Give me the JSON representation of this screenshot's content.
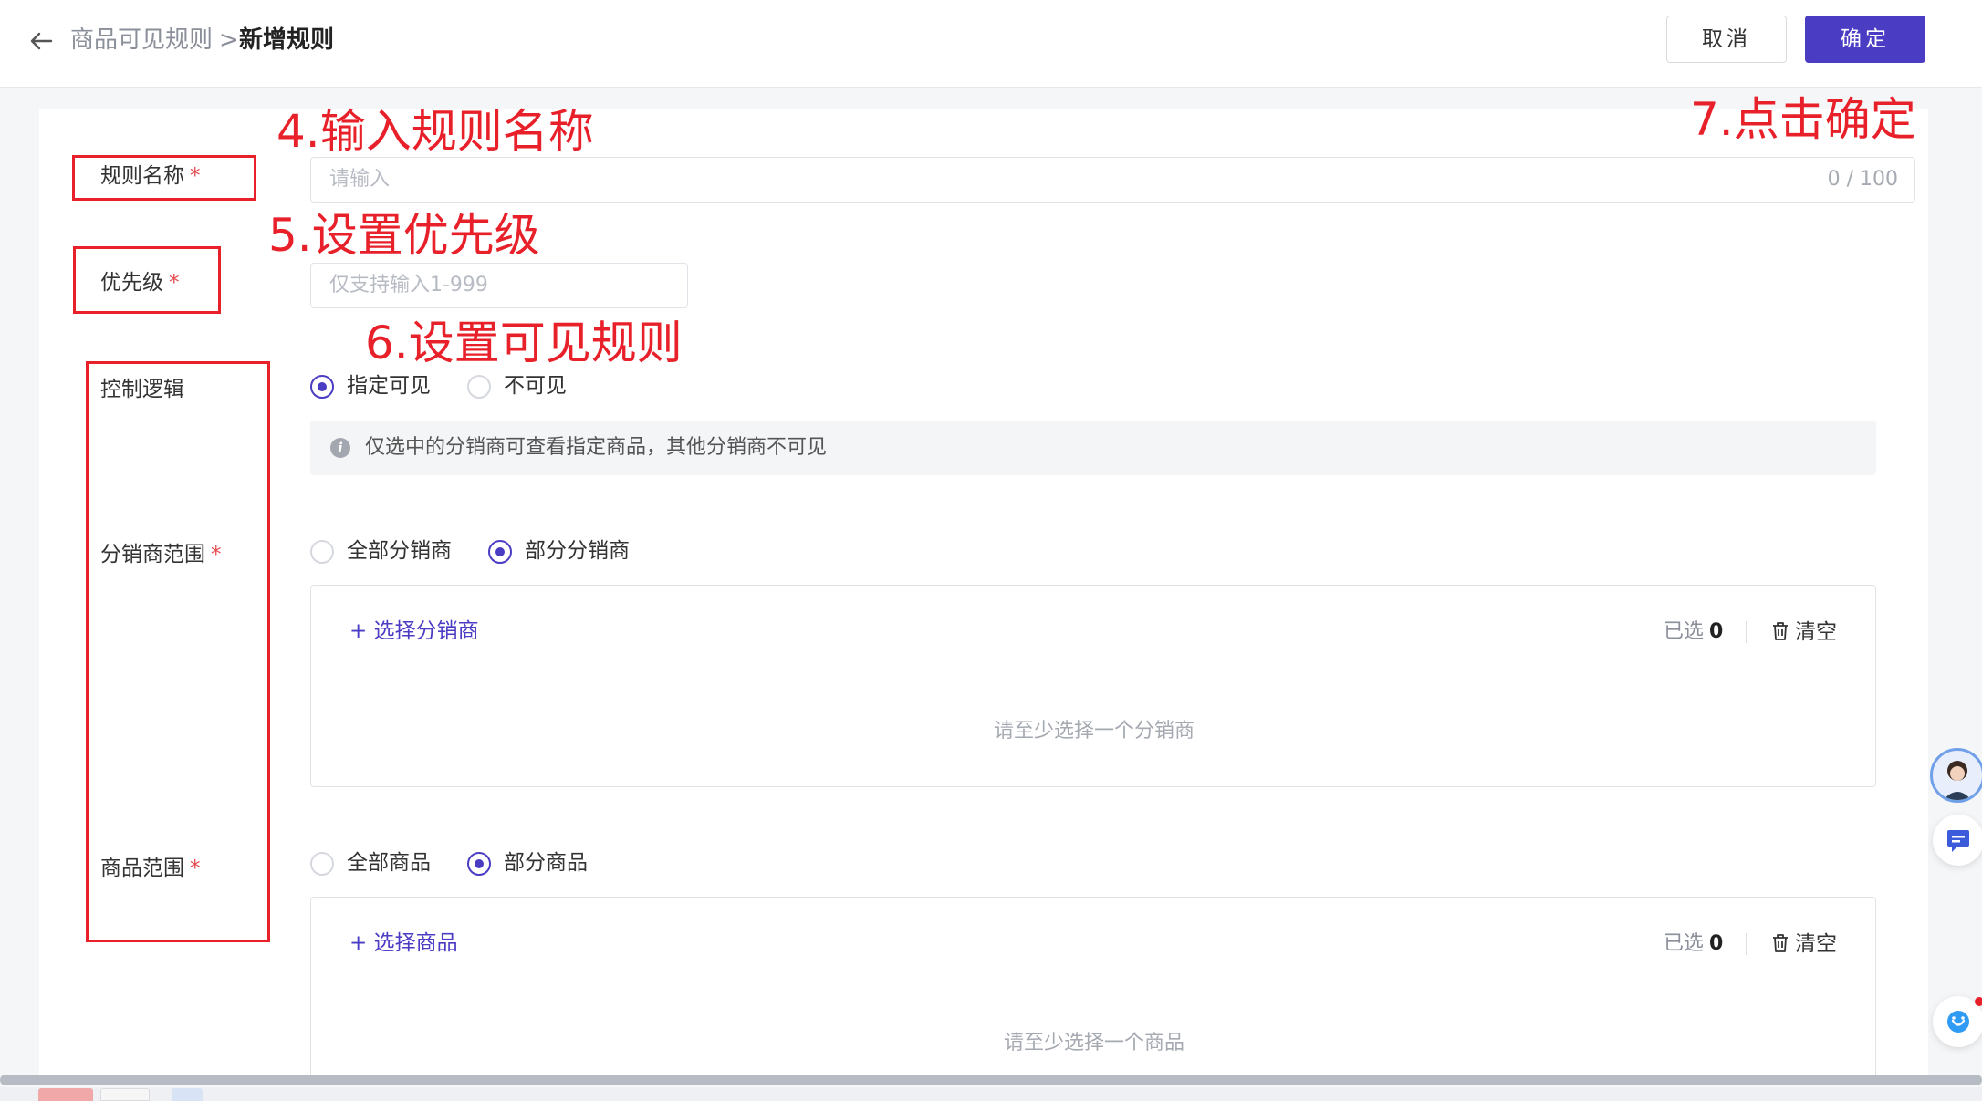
{
  "header": {
    "breadcrumb_parent": "商品可见规则",
    "breadcrumb_separator": ">",
    "breadcrumb_current": "新增规则",
    "cancel_label": "取消",
    "confirm_label": "确定"
  },
  "form": {
    "rule_name": {
      "label": "规则名称",
      "required_mark": "*",
      "placeholder": "请输入",
      "counter": "0 / 100"
    },
    "priority": {
      "label": "优先级",
      "required_mark": "*",
      "placeholder": "仅支持输入1-999"
    },
    "control_logic": {
      "label": "控制逻辑",
      "options": [
        {
          "label": "指定可见",
          "selected": true
        },
        {
          "label": "不可见",
          "selected": false
        }
      ],
      "tip": "仅选中的分销商可查看指定商品，其他分销商不可见"
    },
    "distributor_scope": {
      "label": "分销商范围",
      "required_mark": "*",
      "options": [
        {
          "label": "全部分销商",
          "selected": false
        },
        {
          "label": "部分分销商",
          "selected": true
        }
      ],
      "select_link": "+ 选择分销商",
      "selected_label": "已选",
      "selected_count": "0",
      "clear_label": "清空",
      "empty_text": "请至少选择一个分销商"
    },
    "product_scope": {
      "label": "商品范围",
      "required_mark": "*",
      "options": [
        {
          "label": "全部商品",
          "selected": false
        },
        {
          "label": "部分商品",
          "selected": true
        }
      ],
      "select_link": "+ 选择商品",
      "selected_label": "已选",
      "selected_count": "0",
      "clear_label": "清空",
      "empty_text": "请至少选择一个商品"
    }
  },
  "annotations": {
    "step4": "4.输入规则名称",
    "step5": "5.设置优先级",
    "step6": "6.设置可见规则",
    "step7": "7.点击确定"
  },
  "colors": {
    "primary": "#4b3cc4",
    "annotation_red": "#e8202a",
    "required_red": "#e5484d"
  }
}
